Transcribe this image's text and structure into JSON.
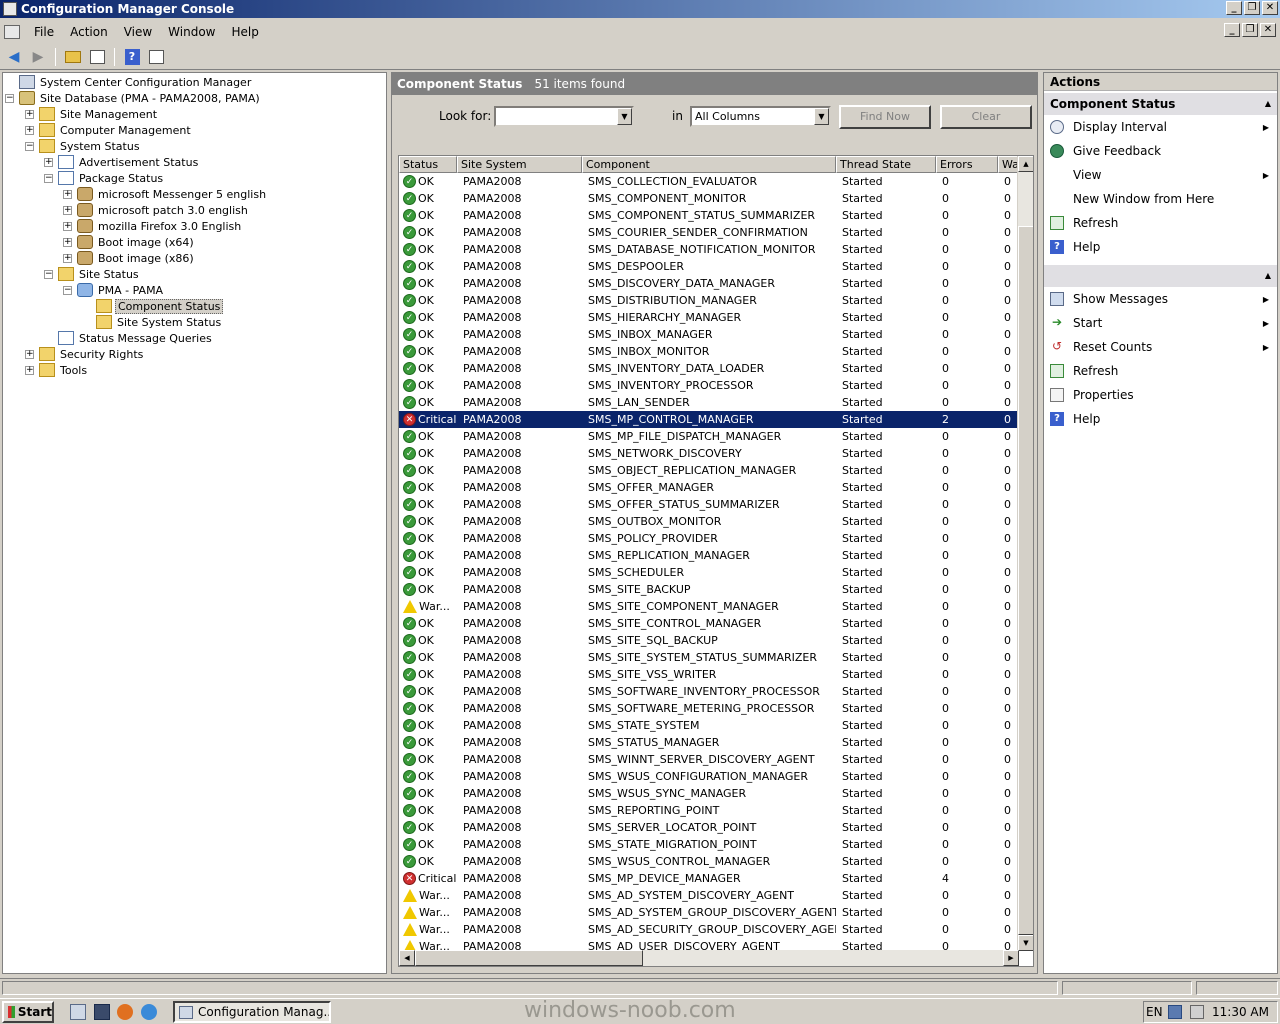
{
  "window": {
    "title": "Configuration Manager Console"
  },
  "menu": [
    "File",
    "Action",
    "View",
    "Window",
    "Help"
  ],
  "tree": [
    {
      "label": "System Center Configuration Manager",
      "level": 0,
      "exp": "",
      "icon": "root"
    },
    {
      "label": "Site Database  (PMA - PAMA2008, PAMA)",
      "level": 0,
      "exp": "−",
      "icon": "db"
    },
    {
      "label": "Site Management",
      "level": 1,
      "exp": "+",
      "icon": "folder"
    },
    {
      "label": "Computer Management",
      "level": 1,
      "exp": "+",
      "icon": "folder"
    },
    {
      "label": "System Status",
      "level": 1,
      "exp": "−",
      "icon": "folder"
    },
    {
      "label": "Advertisement Status",
      "level": 2,
      "exp": "+",
      "icon": "status"
    },
    {
      "label": "Package Status",
      "level": 2,
      "exp": "−",
      "icon": "status"
    },
    {
      "label": "microsoft Messenger 5 english",
      "level": 3,
      "exp": "+",
      "icon": "pkg"
    },
    {
      "label": "microsoft patch 3.0 english",
      "level": 3,
      "exp": "+",
      "icon": "pkg"
    },
    {
      "label": "mozilla Firefox 3.0 English",
      "level": 3,
      "exp": "+",
      "icon": "pkg"
    },
    {
      "label": "Boot image (x64)",
      "level": 3,
      "exp": "+",
      "icon": "pkg"
    },
    {
      "label": "Boot image (x86)",
      "level": 3,
      "exp": "+",
      "icon": "pkg"
    },
    {
      "label": "Site Status",
      "level": 2,
      "exp": "−",
      "icon": "folder"
    },
    {
      "label": "PMA - PAMA",
      "level": 3,
      "exp": "−",
      "icon": "site"
    },
    {
      "label": "Component Status",
      "level": 4,
      "exp": "",
      "icon": "folder",
      "selected": true
    },
    {
      "label": "Site System Status",
      "level": 4,
      "exp": "",
      "icon": "folder"
    },
    {
      "label": "Status Message Queries",
      "level": 2,
      "exp": "",
      "icon": "status"
    },
    {
      "label": "Security Rights",
      "level": 1,
      "exp": "+",
      "icon": "folder"
    },
    {
      "label": "Tools",
      "level": 1,
      "exp": "+",
      "icon": "folder"
    }
  ],
  "center": {
    "title": "Component Status",
    "count": "51 items found",
    "look_for_label": "Look for:",
    "look_for_value": "",
    "in_label": "in",
    "in_value": "All Columns",
    "find_now": "Find Now",
    "clear": "Clear",
    "columns": [
      "Status",
      "Site System",
      "Component",
      "Thread State",
      "Errors",
      "Wa"
    ]
  },
  "rows": [
    {
      "status": "OK",
      "site": "PAMA2008",
      "component": "SMS_COLLECTION_EVALUATOR",
      "thread": "Started",
      "errors": "0",
      "warn": "0"
    },
    {
      "status": "OK",
      "site": "PAMA2008",
      "component": "SMS_COMPONENT_MONITOR",
      "thread": "Started",
      "errors": "0",
      "warn": "0"
    },
    {
      "status": "OK",
      "site": "PAMA2008",
      "component": "SMS_COMPONENT_STATUS_SUMMARIZER",
      "thread": "Started",
      "errors": "0",
      "warn": "0"
    },
    {
      "status": "OK",
      "site": "PAMA2008",
      "component": "SMS_COURIER_SENDER_CONFIRMATION",
      "thread": "Started",
      "errors": "0",
      "warn": "0"
    },
    {
      "status": "OK",
      "site": "PAMA2008",
      "component": "SMS_DATABASE_NOTIFICATION_MONITOR",
      "thread": "Started",
      "errors": "0",
      "warn": "0"
    },
    {
      "status": "OK",
      "site": "PAMA2008",
      "component": "SMS_DESPOOLER",
      "thread": "Started",
      "errors": "0",
      "warn": "0"
    },
    {
      "status": "OK",
      "site": "PAMA2008",
      "component": "SMS_DISCOVERY_DATA_MANAGER",
      "thread": "Started",
      "errors": "0",
      "warn": "0"
    },
    {
      "status": "OK",
      "site": "PAMA2008",
      "component": "SMS_DISTRIBUTION_MANAGER",
      "thread": "Started",
      "errors": "0",
      "warn": "0"
    },
    {
      "status": "OK",
      "site": "PAMA2008",
      "component": "SMS_HIERARCHY_MANAGER",
      "thread": "Started",
      "errors": "0",
      "warn": "0"
    },
    {
      "status": "OK",
      "site": "PAMA2008",
      "component": "SMS_INBOX_MANAGER",
      "thread": "Started",
      "errors": "0",
      "warn": "0"
    },
    {
      "status": "OK",
      "site": "PAMA2008",
      "component": "SMS_INBOX_MONITOR",
      "thread": "Started",
      "errors": "0",
      "warn": "0"
    },
    {
      "status": "OK",
      "site": "PAMA2008",
      "component": "SMS_INVENTORY_DATA_LOADER",
      "thread": "Started",
      "errors": "0",
      "warn": "0"
    },
    {
      "status": "OK",
      "site": "PAMA2008",
      "component": "SMS_INVENTORY_PROCESSOR",
      "thread": "Started",
      "errors": "0",
      "warn": "0"
    },
    {
      "status": "OK",
      "site": "PAMA2008",
      "component": "SMS_LAN_SENDER",
      "thread": "Started",
      "errors": "0",
      "warn": "0"
    },
    {
      "status": "Critical",
      "site": "PAMA2008",
      "component": "SMS_MP_CONTROL_MANAGER",
      "thread": "Started",
      "errors": "2",
      "warn": "0",
      "selected": true
    },
    {
      "status": "OK",
      "site": "PAMA2008",
      "component": "SMS_MP_FILE_DISPATCH_MANAGER",
      "thread": "Started",
      "errors": "0",
      "warn": "0"
    },
    {
      "status": "OK",
      "site": "PAMA2008",
      "component": "SMS_NETWORK_DISCOVERY",
      "thread": "Started",
      "errors": "0",
      "warn": "0"
    },
    {
      "status": "OK",
      "site": "PAMA2008",
      "component": "SMS_OBJECT_REPLICATION_MANAGER",
      "thread": "Started",
      "errors": "0",
      "warn": "0"
    },
    {
      "status": "OK",
      "site": "PAMA2008",
      "component": "SMS_OFFER_MANAGER",
      "thread": "Started",
      "errors": "0",
      "warn": "0"
    },
    {
      "status": "OK",
      "site": "PAMA2008",
      "component": "SMS_OFFER_STATUS_SUMMARIZER",
      "thread": "Started",
      "errors": "0",
      "warn": "0"
    },
    {
      "status": "OK",
      "site": "PAMA2008",
      "component": "SMS_OUTBOX_MONITOR",
      "thread": "Started",
      "errors": "0",
      "warn": "0"
    },
    {
      "status": "OK",
      "site": "PAMA2008",
      "component": "SMS_POLICY_PROVIDER",
      "thread": "Started",
      "errors": "0",
      "warn": "0"
    },
    {
      "status": "OK",
      "site": "PAMA2008",
      "component": "SMS_REPLICATION_MANAGER",
      "thread": "Started",
      "errors": "0",
      "warn": "0"
    },
    {
      "status": "OK",
      "site": "PAMA2008",
      "component": "SMS_SCHEDULER",
      "thread": "Started",
      "errors": "0",
      "warn": "0"
    },
    {
      "status": "OK",
      "site": "PAMA2008",
      "component": "SMS_SITE_BACKUP",
      "thread": "Started",
      "errors": "0",
      "warn": "0"
    },
    {
      "status": "War...",
      "site": "PAMA2008",
      "component": "SMS_SITE_COMPONENT_MANAGER",
      "thread": "Started",
      "errors": "0",
      "warn": "0"
    },
    {
      "status": "OK",
      "site": "PAMA2008",
      "component": "SMS_SITE_CONTROL_MANAGER",
      "thread": "Started",
      "errors": "0",
      "warn": "0"
    },
    {
      "status": "OK",
      "site": "PAMA2008",
      "component": "SMS_SITE_SQL_BACKUP",
      "thread": "Started",
      "errors": "0",
      "warn": "0"
    },
    {
      "status": "OK",
      "site": "PAMA2008",
      "component": "SMS_SITE_SYSTEM_STATUS_SUMMARIZER",
      "thread": "Started",
      "errors": "0",
      "warn": "0"
    },
    {
      "status": "OK",
      "site": "PAMA2008",
      "component": "SMS_SITE_VSS_WRITER",
      "thread": "Started",
      "errors": "0",
      "warn": "0"
    },
    {
      "status": "OK",
      "site": "PAMA2008",
      "component": "SMS_SOFTWARE_INVENTORY_PROCESSOR",
      "thread": "Started",
      "errors": "0",
      "warn": "0"
    },
    {
      "status": "OK",
      "site": "PAMA2008",
      "component": "SMS_SOFTWARE_METERING_PROCESSOR",
      "thread": "Started",
      "errors": "0",
      "warn": "0"
    },
    {
      "status": "OK",
      "site": "PAMA2008",
      "component": "SMS_STATE_SYSTEM",
      "thread": "Started",
      "errors": "0",
      "warn": "0"
    },
    {
      "status": "OK",
      "site": "PAMA2008",
      "component": "SMS_STATUS_MANAGER",
      "thread": "Started",
      "errors": "0",
      "warn": "0"
    },
    {
      "status": "OK",
      "site": "PAMA2008",
      "component": "SMS_WINNT_SERVER_DISCOVERY_AGENT",
      "thread": "Started",
      "errors": "0",
      "warn": "0"
    },
    {
      "status": "OK",
      "site": "PAMA2008",
      "component": "SMS_WSUS_CONFIGURATION_MANAGER",
      "thread": "Started",
      "errors": "0",
      "warn": "0"
    },
    {
      "status": "OK",
      "site": "PAMA2008",
      "component": "SMS_WSUS_SYNC_MANAGER",
      "thread": "Started",
      "errors": "0",
      "warn": "0"
    },
    {
      "status": "OK",
      "site": "PAMA2008",
      "component": "SMS_REPORTING_POINT",
      "thread": "Started",
      "errors": "0",
      "warn": "0"
    },
    {
      "status": "OK",
      "site": "PAMA2008",
      "component": "SMS_SERVER_LOCATOR_POINT",
      "thread": "Started",
      "errors": "0",
      "warn": "0"
    },
    {
      "status": "OK",
      "site": "PAMA2008",
      "component": "SMS_STATE_MIGRATION_POINT",
      "thread": "Started",
      "errors": "0",
      "warn": "0"
    },
    {
      "status": "OK",
      "site": "PAMA2008",
      "component": "SMS_WSUS_CONTROL_MANAGER",
      "thread": "Started",
      "errors": "0",
      "warn": "0"
    },
    {
      "status": "Critical",
      "site": "PAMA2008",
      "component": "SMS_MP_DEVICE_MANAGER",
      "thread": "Started",
      "errors": "4",
      "warn": "0"
    },
    {
      "status": "War...",
      "site": "PAMA2008",
      "component": "SMS_AD_SYSTEM_DISCOVERY_AGENT",
      "thread": "Started",
      "errors": "0",
      "warn": "0"
    },
    {
      "status": "War...",
      "site": "PAMA2008",
      "component": "SMS_AD_SYSTEM_GROUP_DISCOVERY_AGENT",
      "thread": "Started",
      "errors": "0",
      "warn": "0"
    },
    {
      "status": "War...",
      "site": "PAMA2008",
      "component": "SMS_AD_SECURITY_GROUP_DISCOVERY_AGENT",
      "thread": "Started",
      "errors": "0",
      "warn": "0"
    },
    {
      "status": "War...",
      "site": "PAMA2008",
      "component": "SMS_AD_USER_DISCOVERY_AGENT",
      "thread": "Started",
      "errors": "0",
      "warn": "0"
    }
  ],
  "actions": {
    "title": "Actions",
    "section1": "Component Status",
    "items1": [
      {
        "label": "Display Interval",
        "icon": "clock",
        "sub": true
      },
      {
        "label": "Give Feedback",
        "icon": "globe",
        "sub": false
      },
      {
        "label": "View",
        "icon": "",
        "sub": true
      },
      {
        "label": "New Window from Here",
        "icon": "",
        "sub": false
      },
      {
        "label": "Refresh",
        "icon": "refresh",
        "sub": false
      },
      {
        "label": "Help",
        "icon": "help",
        "sub": false
      }
    ],
    "items2": [
      {
        "label": "Show Messages",
        "icon": "msg",
        "sub": true
      },
      {
        "label": "Start",
        "icon": "start",
        "sub": true
      },
      {
        "label": "Reset Counts",
        "icon": "reset",
        "sub": true
      },
      {
        "label": "Refresh",
        "icon": "refresh",
        "sub": false
      },
      {
        "label": "Properties",
        "icon": "props",
        "sub": false
      },
      {
        "label": "Help",
        "icon": "help",
        "sub": false
      }
    ]
  },
  "taskbar": {
    "start": "Start",
    "task": "Configuration Manag...",
    "watermark": "windows-noob.com",
    "lang": "EN",
    "clock": "11:30 AM"
  },
  "colors": {
    "selection": "#0a246a",
    "ok": "#3a9a3a",
    "critical": "#d03030",
    "warning": "#f0c800"
  }
}
